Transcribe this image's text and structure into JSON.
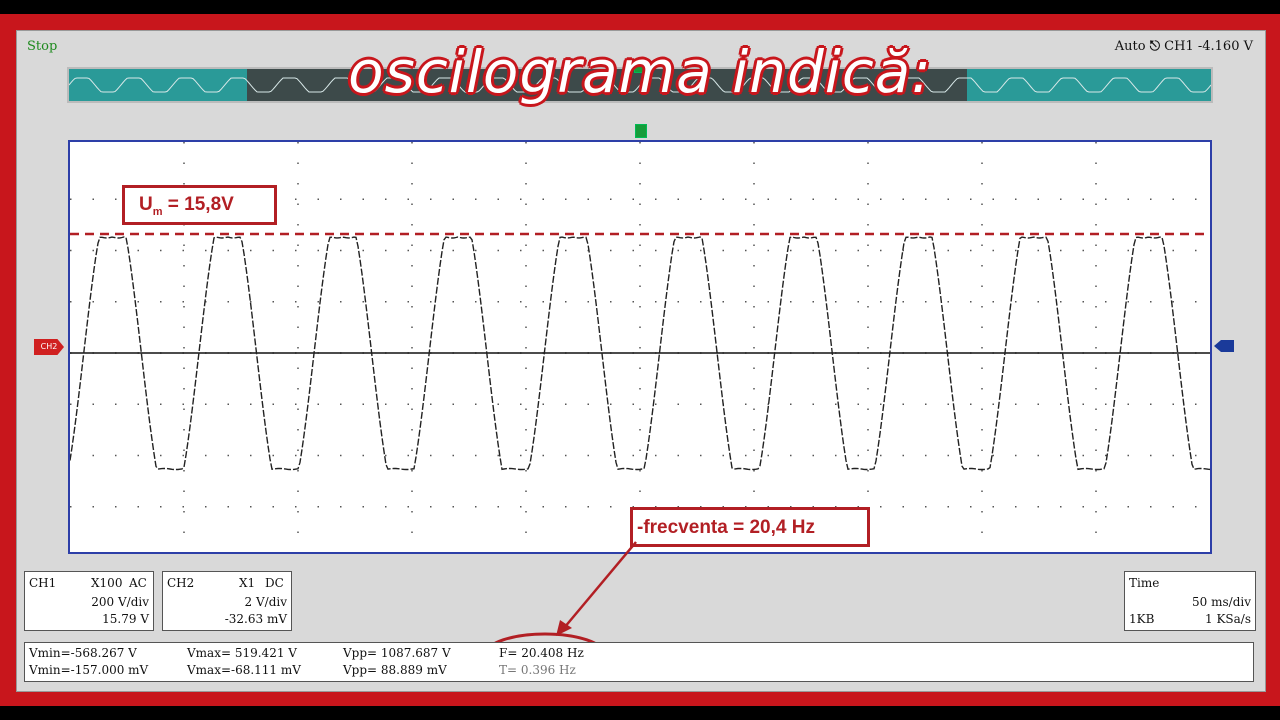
{
  "header": {
    "status": "Stop",
    "trigger_mode": "Auto",
    "trigger_channel": "CH1",
    "trigger_level": "-4.160 V",
    "trigger_icon": "trigger-icon"
  },
  "overlay_title": "oscilograma indică:",
  "annotations": {
    "peak_label_main": "U",
    "peak_label_sub": "m",
    "peak_label_rest": " = 15,8V",
    "frequency_label": "-frecventa = 20,4 Hz"
  },
  "waveform": {
    "peaks_visible": 10,
    "color_trace": "#222222",
    "color_dashed_level": "#b21f24",
    "color_zero_line": "#111111"
  },
  "markers": {
    "ch2_marker": "CH2"
  },
  "ch1": {
    "name": "CH1",
    "probe": "X100",
    "coupling": "AC",
    "volts_div": "200 V/div",
    "offset": "15.79 V"
  },
  "ch2": {
    "name": "CH2",
    "probe": "X1",
    "coupling": "DC",
    "volts_div": "2 V/div",
    "offset": "-32.63 mV"
  },
  "timebase": {
    "title": "Time",
    "value": "50 ms/div",
    "memory": "1KB",
    "sample_rate": "1 KSa/s"
  },
  "measurements": {
    "vmin1": "Vmin=-568.267 V",
    "vmin2": "Vmin=-157.000 mV",
    "vmax1": "Vmax= 519.421 V",
    "vmax2": "Vmax=-68.111 mV",
    "vpp1": "Vpp= 1087.687 V",
    "vpp2": "Vpp= 88.889 mV",
    "freq": "F= 20.408 Hz",
    "period": "T= 0.396 Hz"
  },
  "colors": {
    "frame": "#c8161c",
    "accent_red": "#b21f24",
    "plot_border": "#2d3fa8",
    "overview_bg": "#2a9a98",
    "status_green": "#1e8a1e"
  }
}
